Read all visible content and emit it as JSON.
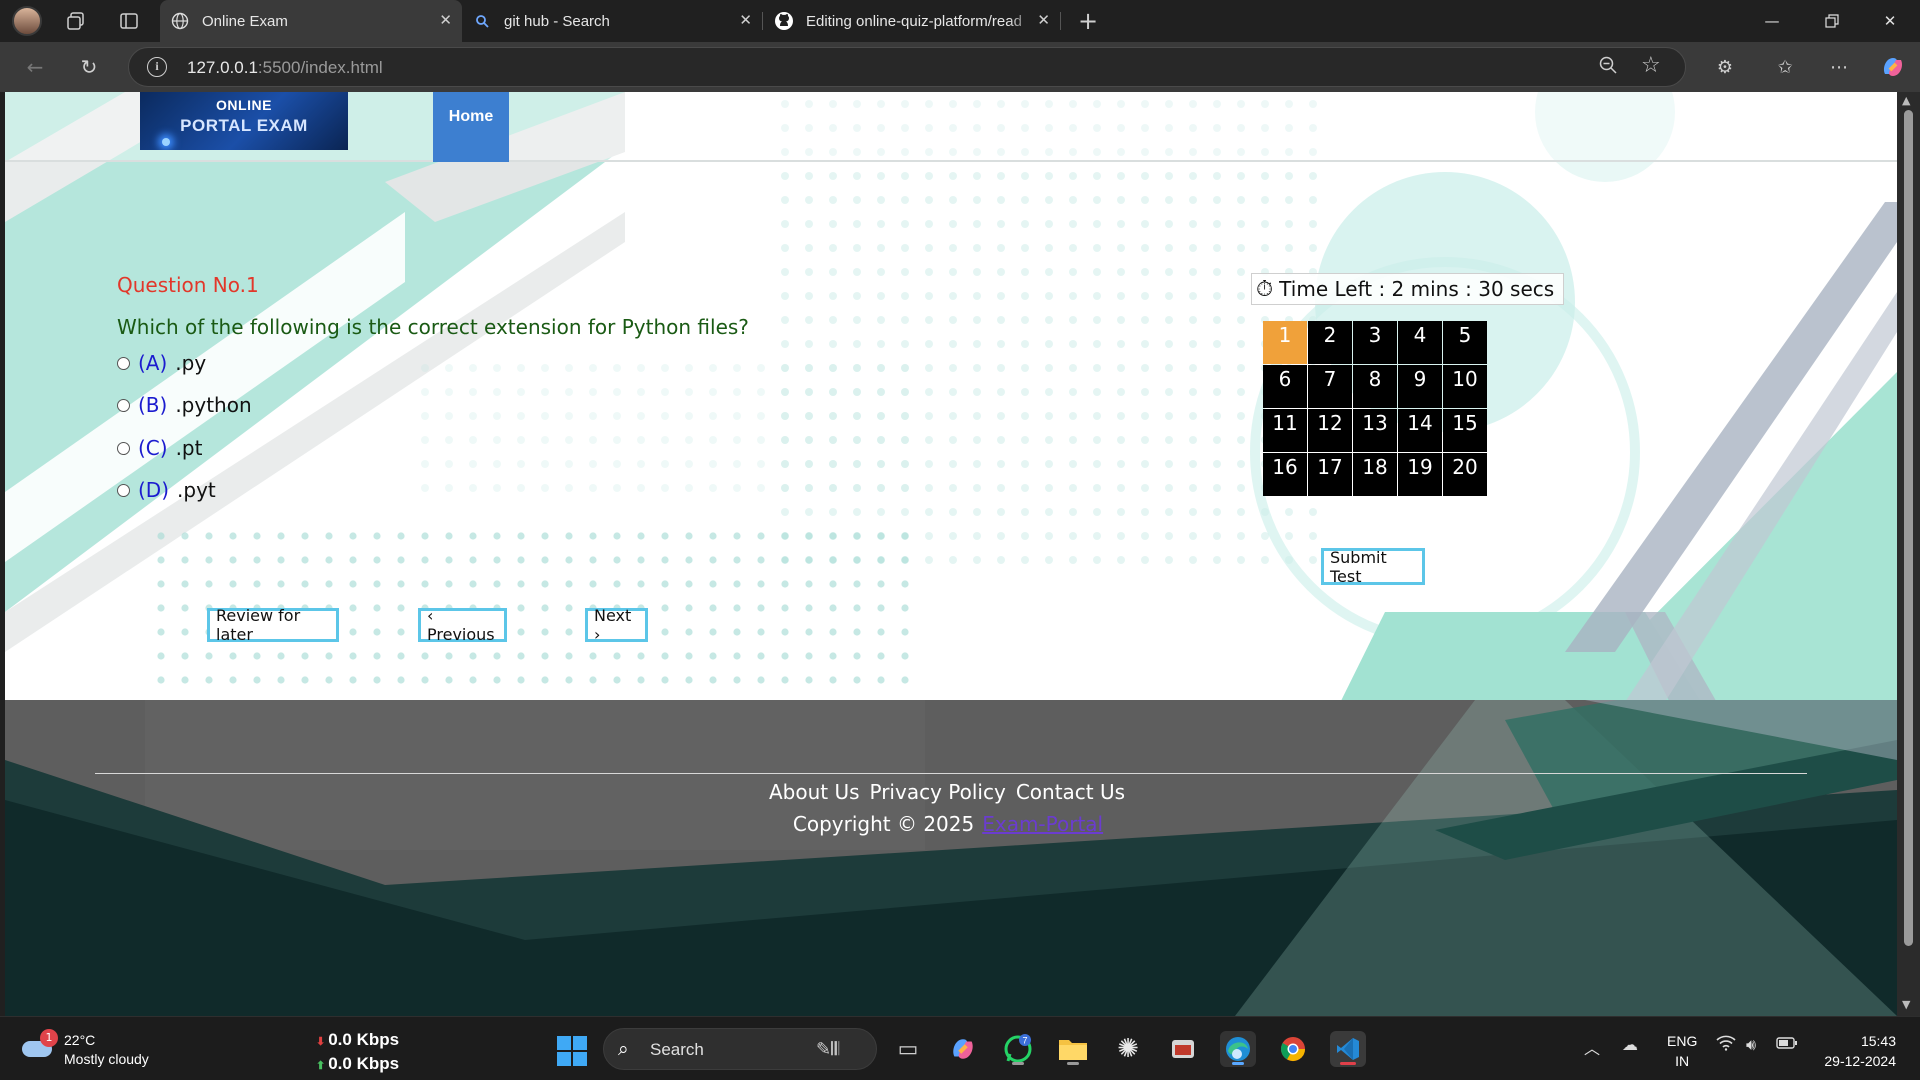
{
  "browser": {
    "tabs": [
      {
        "title": "Online Exam",
        "active": true
      },
      {
        "title": "git hub - Search",
        "active": false
      },
      {
        "title": "Editing online-quiz-platform/read",
        "active": false
      }
    ],
    "url_host": "127.0.0.1",
    "url_path": ":5500/index.html"
  },
  "site": {
    "logo_line1": "ONLINE",
    "logo_line2": "PORTAL EXAM",
    "nav_home": "Home"
  },
  "question": {
    "number_label": "Question No.1",
    "text": "Which of the following is the correct extension for Python files?",
    "options": [
      {
        "letter": "(A)",
        "value": ".py"
      },
      {
        "letter": "(B)",
        "value": ".python"
      },
      {
        "letter": "(C)",
        "value": ".pt"
      },
      {
        "letter": "(D)",
        "value": ".pyt"
      }
    ]
  },
  "buttons": {
    "review": "Review for later",
    "previous": "‹ Previous",
    "next": "Next ›",
    "submit": "Submit Test"
  },
  "timer": {
    "label": "Time Left : 2 mins : 30 secs"
  },
  "question_grid": {
    "current": 1,
    "numbers": [
      "1",
      "2",
      "3",
      "4",
      "5",
      "6",
      "7",
      "8",
      "9",
      "10",
      "11",
      "12",
      "13",
      "14",
      "15",
      "16",
      "17",
      "18",
      "19",
      "20"
    ]
  },
  "footer": {
    "links": [
      "About Us",
      "Privacy Policy",
      "Contact Us"
    ],
    "copyright_prefix": "Copyright © 2025",
    "portal_link": "Exam-Portal"
  },
  "taskbar": {
    "weather_badge": "1",
    "temperature": "22°C",
    "condition": "Mostly cloudy",
    "net_down": "0.0 Kbps",
    "net_up": "0.0 Kbps",
    "search_label": "Search",
    "whatsapp_badge": "7",
    "lang_line1": "ENG",
    "lang_line2": "IN",
    "time": "15:43",
    "date": "29-12-2024"
  }
}
